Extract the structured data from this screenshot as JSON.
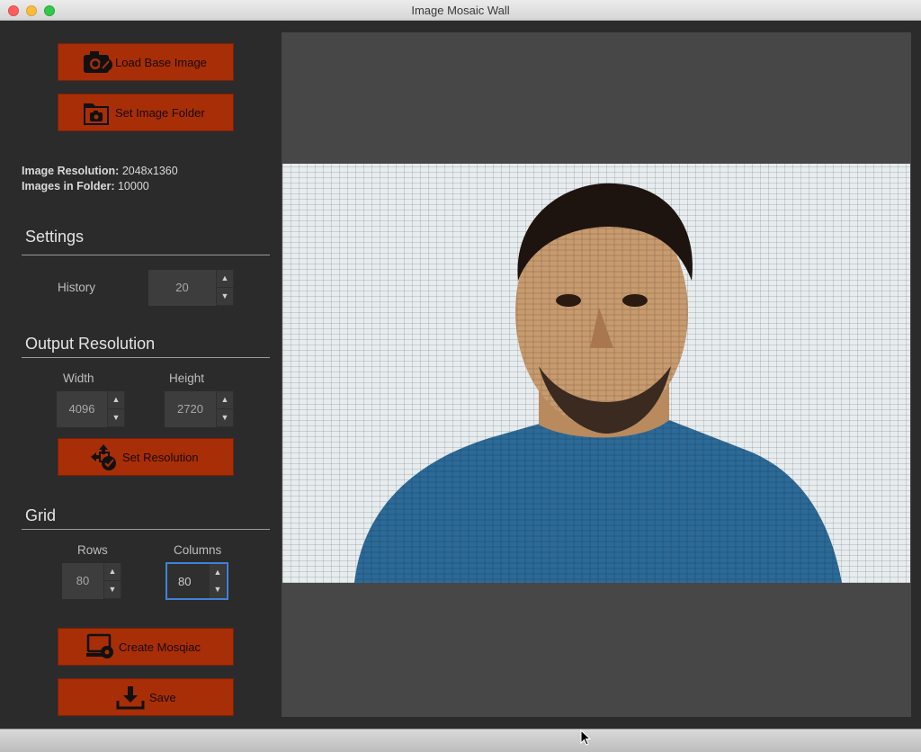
{
  "window": {
    "title": "Image Mosaic Wall"
  },
  "buttons": {
    "load_base_image": "Load Base Image",
    "set_image_folder": "Set Image Folder",
    "set_resolution": "Set Resolution",
    "create_mosaic": "Create Mosqiac",
    "save": "Save"
  },
  "info": {
    "resolution_label": "Image Resolution:",
    "resolution_value": "2048x1360",
    "folder_label": "Images in Folder:",
    "folder_value": "10000"
  },
  "settings": {
    "heading": "Settings",
    "history_label": "History",
    "history_value": "20"
  },
  "output_resolution": {
    "heading": "Output Resolution",
    "width_label": "Width",
    "width_value": "4096",
    "height_label": "Height",
    "height_value": "2720"
  },
  "grid": {
    "heading": "Grid",
    "rows_label": "Rows",
    "rows_value": "80",
    "columns_label": "Columns",
    "columns_value": "80"
  },
  "colors": {
    "button_bg": "#a72e06",
    "panel_bg": "#2b2b2b",
    "canvas_bg": "#474747",
    "focus_ring": "#3f82d8"
  },
  "icons": {
    "load_base_image": "camera-edit-icon",
    "set_image_folder": "folder-camera-icon",
    "set_resolution": "resize-arrows-icon",
    "create_mosaic": "monitor-gear-icon",
    "save": "download-icon"
  }
}
